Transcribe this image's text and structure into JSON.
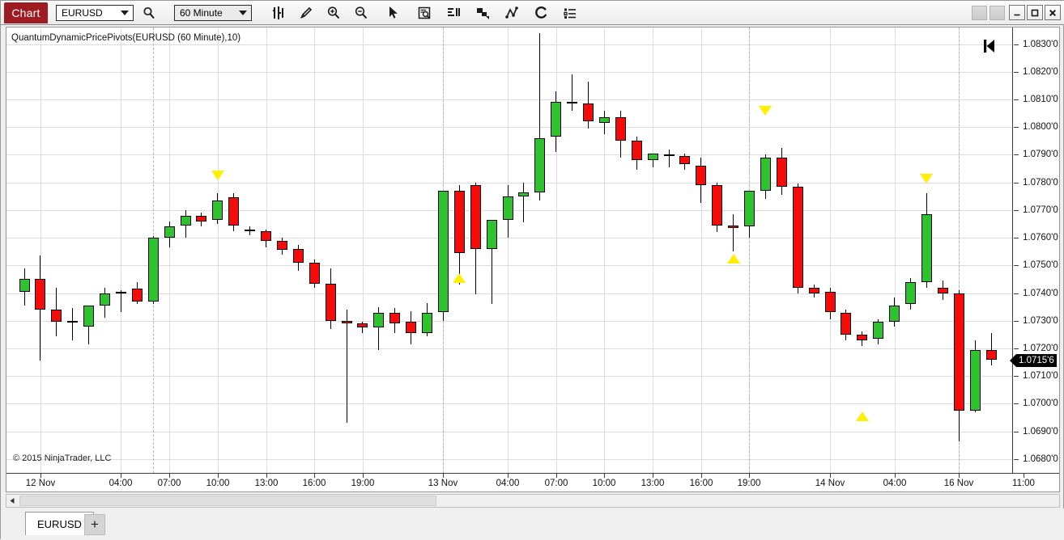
{
  "toolbar": {
    "chart_button": "Chart",
    "symbol": "EURUSD",
    "period": "60 Minute",
    "icons": [
      "bar-chart-icon",
      "pencil-icon",
      "zoom-in-icon",
      "zoom-out-icon",
      "cursor-icon",
      "data-box-icon",
      "indicators-icon",
      "drawing-objects-icon",
      "polyline-icon",
      "reload-icon",
      "properties-list-icon"
    ],
    "window_buttons": [
      "minimize",
      "maximize",
      "close"
    ]
  },
  "chart": {
    "title": "QuantumDynamicPricePivots(EURUSD (60 Minute),10)",
    "copyright": "© 2015 NinjaTrader, LLC",
    "goto_icon": "skip-to-start-icon",
    "current_price": "1.0715'6",
    "colors": {
      "up": "#2ec22e",
      "down": "#f60b0b",
      "marker": "#ffef00",
      "accent": "#9e1b22",
      "grid": "#dcdcdc"
    }
  },
  "tabs": {
    "items": [
      "EURUSD"
    ],
    "add_label": "+"
  },
  "chart_data": {
    "type": "candlestick",
    "title": "QuantumDynamicPricePivots(EURUSD (60 Minute),10)",
    "symbol": "EURUSD",
    "interval": "60 Minute",
    "xlabel": "",
    "ylabel": "",
    "ylim": [
      1.0675,
      1.0836
    ],
    "grid": true,
    "legend": "none",
    "y_ticks": [
      "1.0830'0",
      "1.0820'0",
      "1.0810'0",
      "1.0800'0",
      "1.0790'0",
      "1.0780'0",
      "1.0770'0",
      "1.0760'0",
      "1.0750'0",
      "1.0740'0",
      "1.0730'0",
      "1.0720'0",
      "1.0710'0",
      "1.0700'0",
      "1.0690'0",
      "1.0680'0"
    ],
    "y_tick_values": [
      1.083,
      1.082,
      1.081,
      1.08,
      1.079,
      1.078,
      1.077,
      1.076,
      1.075,
      1.074,
      1.073,
      1.072,
      1.071,
      1.07,
      1.069,
      1.068
    ],
    "x_ticks": [
      {
        "label": "12 Nov",
        "index": 1
      },
      {
        "label": "04:00",
        "index": 6
      },
      {
        "label": "07:00",
        "index": 9
      },
      {
        "label": "10:00",
        "index": 12
      },
      {
        "label": "13:00",
        "index": 15
      },
      {
        "label": "16:00",
        "index": 18
      },
      {
        "label": "19:00",
        "index": 21
      },
      {
        "label": "13 Nov",
        "index": 26
      },
      {
        "label": "04:00",
        "index": 30
      },
      {
        "label": "07:00",
        "index": 33
      },
      {
        "label": "10:00",
        "index": 36
      },
      {
        "label": "13:00",
        "index": 39
      },
      {
        "label": "16:00",
        "index": 42
      },
      {
        "label": "19:00",
        "index": 45
      },
      {
        "label": "14 Nov",
        "index": 50
      },
      {
        "label": "04:00",
        "index": 54
      },
      {
        "label": "16 Nov",
        "index": 58
      },
      {
        "label": "11:00",
        "index": 62
      }
    ],
    "day_separators": [
      8,
      26,
      45,
      58
    ],
    "candles": [
      {
        "o": 1.07405,
        "h": 1.0749,
        "l": 1.07355,
        "c": 1.0745
      },
      {
        "o": 1.0745,
        "h": 1.07535,
        "l": 1.07155,
        "c": 1.0734
      },
      {
        "o": 1.0734,
        "h": 1.0742,
        "l": 1.07245,
        "c": 1.07295
      },
      {
        "o": 1.07295,
        "h": 1.07345,
        "l": 1.0723,
        "c": 1.073
      },
      {
        "o": 1.0728,
        "h": 1.0734,
        "l": 1.07215,
        "c": 1.07355
      },
      {
        "o": 1.07355,
        "h": 1.0742,
        "l": 1.0731,
        "c": 1.074
      },
      {
        "o": 1.07405,
        "h": 1.0741,
        "l": 1.0733,
        "c": 1.07405
      },
      {
        "o": 1.07415,
        "h": 1.0744,
        "l": 1.0736,
        "c": 1.0737
      },
      {
        "o": 1.0737,
        "h": 1.07605,
        "l": 1.0736,
        "c": 1.076
      },
      {
        "o": 1.076,
        "h": 1.0766,
        "l": 1.07565,
        "c": 1.0764
      },
      {
        "o": 1.07645,
        "h": 1.077,
        "l": 1.076,
        "c": 1.0768
      },
      {
        "o": 1.0768,
        "h": 1.0769,
        "l": 1.0764,
        "c": 1.0766
      },
      {
        "o": 1.07665,
        "h": 1.0776,
        "l": 1.0765,
        "c": 1.07735
      },
      {
        "o": 1.07745,
        "h": 1.0776,
        "l": 1.07625,
        "c": 1.07645
      },
      {
        "o": 1.0763,
        "h": 1.0764,
        "l": 1.0761,
        "c": 1.07625
      },
      {
        "o": 1.07625,
        "h": 1.0763,
        "l": 1.07565,
        "c": 1.0759
      },
      {
        "o": 1.0759,
        "h": 1.076,
        "l": 1.0754,
        "c": 1.07555
      },
      {
        "o": 1.0756,
        "h": 1.07575,
        "l": 1.0748,
        "c": 1.0751
      },
      {
        "o": 1.0751,
        "h": 1.0752,
        "l": 1.0742,
        "c": 1.07435
      },
      {
        "o": 1.07435,
        "h": 1.0749,
        "l": 1.0727,
        "c": 1.073
      },
      {
        "o": 1.073,
        "h": 1.0734,
        "l": 1.0693,
        "c": 1.0729
      },
      {
        "o": 1.0729,
        "h": 1.07295,
        "l": 1.07255,
        "c": 1.07275
      },
      {
        "o": 1.07275,
        "h": 1.0735,
        "l": 1.07195,
        "c": 1.0733
      },
      {
        "o": 1.0733,
        "h": 1.07345,
        "l": 1.07255,
        "c": 1.0729
      },
      {
        "o": 1.07295,
        "h": 1.07335,
        "l": 1.07215,
        "c": 1.07255
      },
      {
        "o": 1.07255,
        "h": 1.07365,
        "l": 1.07245,
        "c": 1.0733
      },
      {
        "o": 1.0733,
        "h": 1.07455,
        "l": 1.073,
        "c": 1.0777
      },
      {
        "o": 1.0777,
        "h": 1.0779,
        "l": 1.0743,
        "c": 1.07545
      },
      {
        "o": 1.0779,
        "h": 1.078,
        "l": 1.07395,
        "c": 1.0756
      },
      {
        "o": 1.0756,
        "h": 1.0764,
        "l": 1.0736,
        "c": 1.07665
      },
      {
        "o": 1.07665,
        "h": 1.0779,
        "l": 1.076,
        "c": 1.0775
      },
      {
        "o": 1.0775,
        "h": 1.078,
        "l": 1.07655,
        "c": 1.07765
      },
      {
        "o": 1.07765,
        "h": 1.0834,
        "l": 1.07735,
        "c": 1.0796
      },
      {
        "o": 1.07965,
        "h": 1.0813,
        "l": 1.0791,
        "c": 1.0809
      },
      {
        "o": 1.0809,
        "h": 1.0819,
        "l": 1.0806,
        "c": 1.08085
      },
      {
        "o": 1.08085,
        "h": 1.08165,
        "l": 1.07995,
        "c": 1.0802
      },
      {
        "o": 1.08015,
        "h": 1.0806,
        "l": 1.07975,
        "c": 1.08035
      },
      {
        "o": 1.08035,
        "h": 1.0806,
        "l": 1.0789,
        "c": 1.0795
      },
      {
        "o": 1.0795,
        "h": 1.07965,
        "l": 1.07845,
        "c": 1.0788
      },
      {
        "o": 1.0788,
        "h": 1.07905,
        "l": 1.07855,
        "c": 1.07905
      },
      {
        "o": 1.079,
        "h": 1.0792,
        "l": 1.07855,
        "c": 1.07895
      },
      {
        "o": 1.07895,
        "h": 1.07905,
        "l": 1.07845,
        "c": 1.07865
      },
      {
        "o": 1.0786,
        "h": 1.0789,
        "l": 1.07725,
        "c": 1.0779
      },
      {
        "o": 1.0779,
        "h": 1.078,
        "l": 1.0762,
        "c": 1.07645
      },
      {
        "o": 1.07645,
        "h": 1.07685,
        "l": 1.0755,
        "c": 1.07635
      },
      {
        "o": 1.0764,
        "h": 1.0772,
        "l": 1.076,
        "c": 1.0777
      },
      {
        "o": 1.0777,
        "h": 1.079,
        "l": 1.0774,
        "c": 1.0789
      },
      {
        "o": 1.0789,
        "h": 1.07925,
        "l": 1.07755,
        "c": 1.07785
      },
      {
        "o": 1.07785,
        "h": 1.07795,
        "l": 1.074,
        "c": 1.0742
      },
      {
        "o": 1.0742,
        "h": 1.0743,
        "l": 1.07385,
        "c": 1.074
      },
      {
        "o": 1.07405,
        "h": 1.0742,
        "l": 1.07305,
        "c": 1.0733
      },
      {
        "o": 1.0733,
        "h": 1.0734,
        "l": 1.0723,
        "c": 1.0725
      },
      {
        "o": 1.0725,
        "h": 1.0726,
        "l": 1.0721,
        "c": 1.0723
      },
      {
        "o": 1.07235,
        "h": 1.07305,
        "l": 1.07215,
        "c": 1.07295
      },
      {
        "o": 1.07295,
        "h": 1.07385,
        "l": 1.0728,
        "c": 1.07355
      },
      {
        "o": 1.0736,
        "h": 1.07455,
        "l": 1.0734,
        "c": 1.0744
      },
      {
        "o": 1.0744,
        "h": 1.0776,
        "l": 1.0742,
        "c": 1.07685
      },
      {
        "o": 1.0742,
        "h": 1.07445,
        "l": 1.07375,
        "c": 1.074
      },
      {
        "o": 1.074,
        "h": 1.0741,
        "l": 1.06865,
        "c": 1.06975
      },
      {
        "o": 1.06975,
        "h": 1.0723,
        "l": 1.0697,
        "c": 1.07195
      },
      {
        "o": 1.07195,
        "h": 1.07255,
        "l": 1.0714,
        "c": 1.0716
      }
    ],
    "markers": [
      {
        "type": "down",
        "index": 12,
        "price": 1.07825
      },
      {
        "type": "up",
        "index": 27,
        "price": 1.07455
      },
      {
        "type": "down",
        "index": 46,
        "price": 1.0806
      },
      {
        "type": "up",
        "index": 44,
        "price": 1.07525
      },
      {
        "type": "up",
        "index": 52,
        "price": 1.06955
      },
      {
        "type": "down",
        "index": 56,
        "price": 1.07815
      }
    ]
  }
}
